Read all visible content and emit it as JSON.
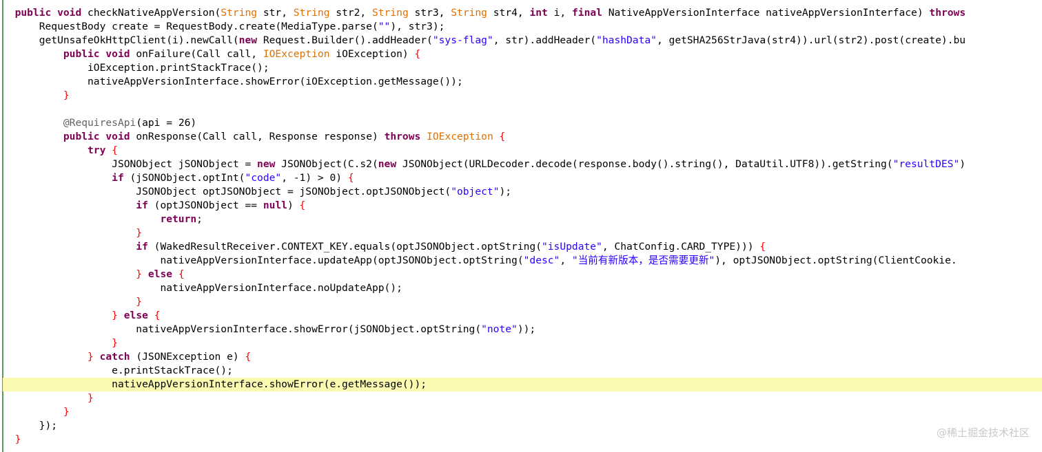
{
  "colors": {
    "keyword": "#7f0055",
    "string": "#2a00ff",
    "annotation": "#646464",
    "exception_type": "#e07000",
    "highlight_bg": "#fbfab0",
    "gutter": "#5a9a5a"
  },
  "watermark": "@稀土掘金技术社区",
  "lines": [
    {
      "indent": "  ",
      "tokens": [
        {
          "t": "kw",
          "v": "public"
        },
        {
          "t": "plain",
          "v": " "
        },
        {
          "t": "kw",
          "v": "void"
        },
        {
          "t": "plain",
          "v": " checkNativeAppVersion("
        },
        {
          "t": "ex",
          "v": "String"
        },
        {
          "t": "plain",
          "v": " str, "
        },
        {
          "t": "ex",
          "v": "String"
        },
        {
          "t": "plain",
          "v": " str2, "
        },
        {
          "t": "ex",
          "v": "String"
        },
        {
          "t": "plain",
          "v": " str3, "
        },
        {
          "t": "ex",
          "v": "String"
        },
        {
          "t": "plain",
          "v": " str4, "
        },
        {
          "t": "kw",
          "v": "int"
        },
        {
          "t": "plain",
          "v": " i, "
        },
        {
          "t": "kw",
          "v": "final"
        },
        {
          "t": "plain",
          "v": " NativeAppVersionInterface nativeAppVersionInterface) "
        },
        {
          "t": "kw",
          "v": "throws"
        }
      ]
    },
    {
      "indent": "      ",
      "tokens": [
        {
          "t": "plain",
          "v": "RequestBody create = RequestBody.create(MediaType.parse("
        },
        {
          "t": "str",
          "v": "\"\""
        },
        {
          "t": "plain",
          "v": "), str3);"
        }
      ]
    },
    {
      "indent": "      ",
      "tokens": [
        {
          "t": "plain",
          "v": "getUnsafeOkHttpClient(i).newCall("
        },
        {
          "t": "kw",
          "v": "new"
        },
        {
          "t": "plain",
          "v": " Request.Builder().addHeader("
        },
        {
          "t": "str",
          "v": "\"sys-flag\""
        },
        {
          "t": "plain",
          "v": ", str).addHeader("
        },
        {
          "t": "str",
          "v": "\"hashData\""
        },
        {
          "t": "plain",
          "v": ", getSHA256StrJava(str4)).url(str2).post(create).bu"
        }
      ]
    },
    {
      "indent": "          ",
      "tokens": [
        {
          "t": "kw",
          "v": "public"
        },
        {
          "t": "plain",
          "v": " "
        },
        {
          "t": "kw",
          "v": "void"
        },
        {
          "t": "plain",
          "v": " onFailure(Call call, "
        },
        {
          "t": "ex",
          "v": "IOException"
        },
        {
          "t": "plain",
          "v": " iOException) "
        },
        {
          "t": "bracket",
          "v": "{"
        }
      ]
    },
    {
      "indent": "              ",
      "tokens": [
        {
          "t": "plain",
          "v": "iOException.printStackTrace();"
        }
      ]
    },
    {
      "indent": "              ",
      "tokens": [
        {
          "t": "plain",
          "v": "nativeAppVersionInterface.showError(iOException.getMessage());"
        }
      ]
    },
    {
      "indent": "          ",
      "tokens": [
        {
          "t": "bracket",
          "v": "}"
        }
      ]
    },
    {
      "indent": "",
      "tokens": []
    },
    {
      "indent": "          ",
      "tokens": [
        {
          "t": "ann",
          "v": "@RequiresApi"
        },
        {
          "t": "plain",
          "v": "(api = 26)"
        }
      ]
    },
    {
      "indent": "          ",
      "tokens": [
        {
          "t": "kw",
          "v": "public"
        },
        {
          "t": "plain",
          "v": " "
        },
        {
          "t": "kw",
          "v": "void"
        },
        {
          "t": "plain",
          "v": " onResponse(Call call, Response response) "
        },
        {
          "t": "kw",
          "v": "throws"
        },
        {
          "t": "plain",
          "v": " "
        },
        {
          "t": "ex",
          "v": "IOException"
        },
        {
          "t": "plain",
          "v": " "
        },
        {
          "t": "bracket",
          "v": "{"
        }
      ]
    },
    {
      "indent": "              ",
      "tokens": [
        {
          "t": "kw",
          "v": "try"
        },
        {
          "t": "plain",
          "v": " "
        },
        {
          "t": "bracket",
          "v": "{"
        }
      ]
    },
    {
      "indent": "                  ",
      "tokens": [
        {
          "t": "plain",
          "v": "JSONObject jSONObject = "
        },
        {
          "t": "kw",
          "v": "new"
        },
        {
          "t": "plain",
          "v": " JSONObject(C.s2("
        },
        {
          "t": "kw",
          "v": "new"
        },
        {
          "t": "plain",
          "v": " JSONObject(URLDecoder.decode(response.body().string(), DataUtil.UTF8)).getString("
        },
        {
          "t": "str",
          "v": "\"resultDES\""
        },
        {
          "t": "plain",
          "v": ")"
        }
      ]
    },
    {
      "indent": "                  ",
      "tokens": [
        {
          "t": "kw",
          "v": "if"
        },
        {
          "t": "plain",
          "v": " (jSONObject.optInt("
        },
        {
          "t": "str",
          "v": "\"code\""
        },
        {
          "t": "plain",
          "v": ", -1) > 0) "
        },
        {
          "t": "bracket",
          "v": "{"
        }
      ]
    },
    {
      "indent": "                      ",
      "tokens": [
        {
          "t": "plain",
          "v": "JSONObject optJSONObject = jSONObject.optJSONObject("
        },
        {
          "t": "str",
          "v": "\"object\""
        },
        {
          "t": "plain",
          "v": ");"
        }
      ]
    },
    {
      "indent": "                      ",
      "tokens": [
        {
          "t": "kw",
          "v": "if"
        },
        {
          "t": "plain",
          "v": " (optJSONObject == "
        },
        {
          "t": "kw",
          "v": "null"
        },
        {
          "t": "plain",
          "v": ") "
        },
        {
          "t": "bracket",
          "v": "{"
        }
      ]
    },
    {
      "indent": "                          ",
      "tokens": [
        {
          "t": "kw",
          "v": "return"
        },
        {
          "t": "plain",
          "v": ";"
        }
      ]
    },
    {
      "indent": "                      ",
      "tokens": [
        {
          "t": "bracket",
          "v": "}"
        }
      ]
    },
    {
      "indent": "                      ",
      "tokens": [
        {
          "t": "kw",
          "v": "if"
        },
        {
          "t": "plain",
          "v": " (WakedResultReceiver.CONTEXT_KEY.equals(optJSONObject.optString("
        },
        {
          "t": "str",
          "v": "\"isUpdate\""
        },
        {
          "t": "plain",
          "v": ", ChatConfig.CARD_TYPE))) "
        },
        {
          "t": "bracket",
          "v": "{"
        }
      ]
    },
    {
      "indent": "                          ",
      "tokens": [
        {
          "t": "plain",
          "v": "nativeAppVersionInterface.updateApp(optJSONObject.optString("
        },
        {
          "t": "str",
          "v": "\"desc\""
        },
        {
          "t": "plain",
          "v": ", "
        },
        {
          "t": "str",
          "v": "\"当前有新版本，是否需要更新\""
        },
        {
          "t": "plain",
          "v": "), optJSONObject.optString(ClientCookie."
        }
      ]
    },
    {
      "indent": "                      ",
      "tokens": [
        {
          "t": "bracket",
          "v": "}"
        },
        {
          "t": "plain",
          "v": " "
        },
        {
          "t": "kw",
          "v": "else"
        },
        {
          "t": "plain",
          "v": " "
        },
        {
          "t": "bracket",
          "v": "{"
        }
      ]
    },
    {
      "indent": "                          ",
      "tokens": [
        {
          "t": "plain",
          "v": "nativeAppVersionInterface.noUpdateApp();"
        }
      ]
    },
    {
      "indent": "                      ",
      "tokens": [
        {
          "t": "bracket",
          "v": "}"
        }
      ]
    },
    {
      "indent": "                  ",
      "tokens": [
        {
          "t": "bracket",
          "v": "}"
        },
        {
          "t": "plain",
          "v": " "
        },
        {
          "t": "kw",
          "v": "else"
        },
        {
          "t": "plain",
          "v": " "
        },
        {
          "t": "bracket",
          "v": "{"
        }
      ]
    },
    {
      "indent": "                      ",
      "tokens": [
        {
          "t": "plain",
          "v": "nativeAppVersionInterface.showError(jSONObject.optString("
        },
        {
          "t": "str",
          "v": "\"note\""
        },
        {
          "t": "plain",
          "v": "));"
        }
      ]
    },
    {
      "indent": "                  ",
      "tokens": [
        {
          "t": "bracket",
          "v": "}"
        }
      ]
    },
    {
      "indent": "              ",
      "tokens": [
        {
          "t": "bracket",
          "v": "}"
        },
        {
          "t": "plain",
          "v": " "
        },
        {
          "t": "kw",
          "v": "catch"
        },
        {
          "t": "plain",
          "v": " (JSONException e) "
        },
        {
          "t": "bracket",
          "v": "{"
        }
      ]
    },
    {
      "indent": "                  ",
      "tokens": [
        {
          "t": "plain",
          "v": "e.printStackTrace();"
        }
      ]
    },
    {
      "indent": "                  ",
      "highlight": true,
      "tokens": [
        {
          "t": "plain",
          "v": "nativeAppVersionInterface.showError(e.getMessage());"
        }
      ]
    },
    {
      "indent": "              ",
      "tokens": [
        {
          "t": "bracket",
          "v": "}"
        }
      ]
    },
    {
      "indent": "          ",
      "tokens": [
        {
          "t": "bracket",
          "v": "}"
        }
      ]
    },
    {
      "indent": "      ",
      "tokens": [
        {
          "t": "plain",
          "v": "});"
        }
      ]
    },
    {
      "indent": "  ",
      "tokens": [
        {
          "t": "bracket",
          "v": "}"
        }
      ]
    }
  ]
}
